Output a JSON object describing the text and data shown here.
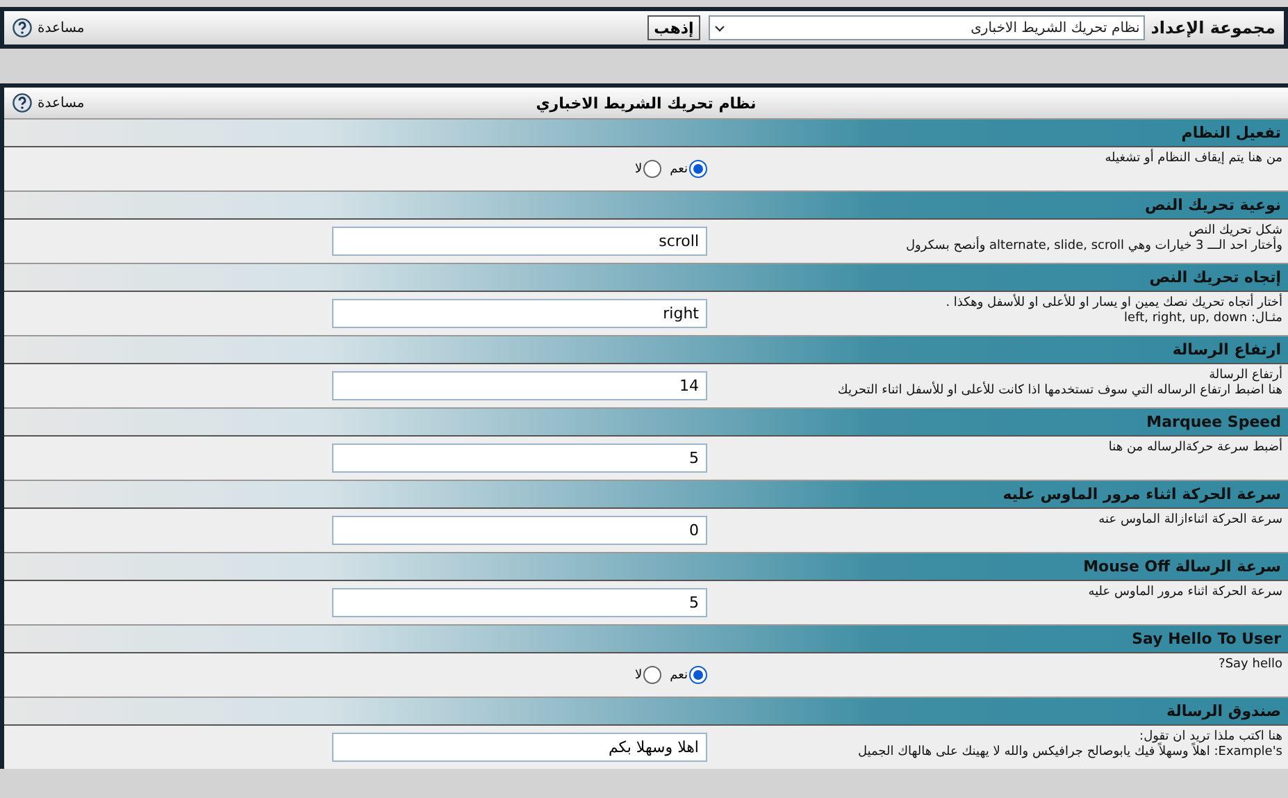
{
  "settings_bar": {
    "label": "مجموعة الإعداد",
    "select_value": "نظام تحريك الشريط الاخبارى",
    "go_button": "إذهب",
    "help": "مساعدة"
  },
  "panel": {
    "title": "نظام تحريك الشريط الاخباري",
    "help": "مساعدة",
    "sections": [
      {
        "title": "تفعيل النظام",
        "kind": "radio",
        "description": [
          "من هنا يتم إيقاف النظام أو تشغيله"
        ],
        "options": [
          {
            "label": "نعم",
            "selected": true
          },
          {
            "label": "لا",
            "selected": false
          }
        ]
      },
      {
        "title": "نوعية تحريك النص",
        "kind": "text",
        "description": [
          "شكل تحريك النص",
          "وأختار احد الـــ 3 خيارات وهي alternate, slide, scroll وأنصح بسكرول"
        ],
        "value": "scroll"
      },
      {
        "title": "إتجاه تحريك النص",
        "kind": "text",
        "description": [
          "أختار أتجاه تحريك نصك يمين او يسار او للأعلى او للأسفل وهكذا .",
          "مثـال: left, right, up, down"
        ],
        "value": "right"
      },
      {
        "title": "ارتفاع الرسالة",
        "kind": "text",
        "description": [
          "أرتفاع الرسالة",
          "هنا اضبط ارتفاع الرساله التي سوف تستخدمها اذا كانت للأعلى او للأسفل اثناء التحريك"
        ],
        "value": "14"
      },
      {
        "title": "Marquee Speed",
        "kind": "text",
        "description": [
          "أضبط سرعة حركةالرساله من هنا"
        ],
        "value": "5"
      },
      {
        "title": "سرعة الحركة اثناء مرور الماوس عليه",
        "kind": "text",
        "description": [
          "سرعة الحركة اثناءازالة الماوس عنه"
        ],
        "value": "0"
      },
      {
        "title": "سرعة الرسالة Mouse Off",
        "kind": "text",
        "description": [
          "سرعة الحركة اثناء مرور الماوس عليه"
        ],
        "value": "5"
      },
      {
        "title": "Say Hello To User",
        "kind": "radio",
        "description": [
          "Say hello?"
        ],
        "options": [
          {
            "label": "نعم",
            "selected": true
          },
          {
            "label": "لا",
            "selected": false
          }
        ]
      },
      {
        "title": "صندوق الرسالة",
        "kind": "text",
        "description": [
          "هنا اكتب ملذا تريد ان تقول:",
          "Example's: اهلاً وسهلاً فيك يابوصالح جرافيكس والله لا يهينك على هالهاك الجميل"
        ],
        "value": "اهلا وسهلا بكم"
      }
    ]
  }
}
